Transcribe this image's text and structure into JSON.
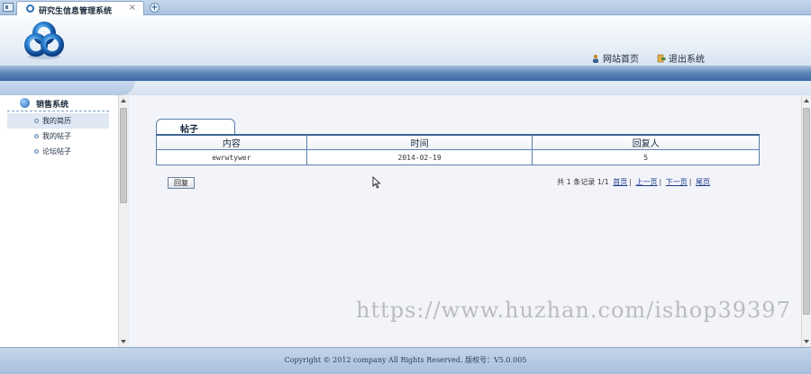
{
  "browser": {
    "tab_title": "研究生信息管理系统",
    "tab_close": "×",
    "new_tab": "+"
  },
  "header": {
    "nav": [
      {
        "label": "网站首页",
        "icon": "person-icon"
      },
      {
        "label": "退出系统",
        "icon": "exit-icon"
      }
    ]
  },
  "sidebar": {
    "title": "销售系统",
    "items": [
      {
        "label": "我的简历"
      },
      {
        "label": "我的帖子"
      },
      {
        "label": "论坛帖子"
      }
    ]
  },
  "main": {
    "tab_label": "帖子",
    "table": {
      "columns": [
        "内容",
        "时间",
        "回复人"
      ],
      "rows": [
        [
          "ewrwtywer",
          "2014-02-19",
          "5"
        ]
      ]
    },
    "reply_button": "回复",
    "pager": {
      "summary": "共 1 条记录 1/1",
      "first": "首页",
      "prev": "上一页",
      "next": "下一页",
      "last": "尾页",
      "sep": "|"
    }
  },
  "footer": {
    "text": "Copyright © 2012 company All Rights Reserved. 版权号：V5.0.005"
  },
  "watermark": "https://www.huzhan.com/ishop39397",
  "colors": {
    "accent_blue": "#3c6aa6",
    "table_border": "#5b7fa8"
  }
}
